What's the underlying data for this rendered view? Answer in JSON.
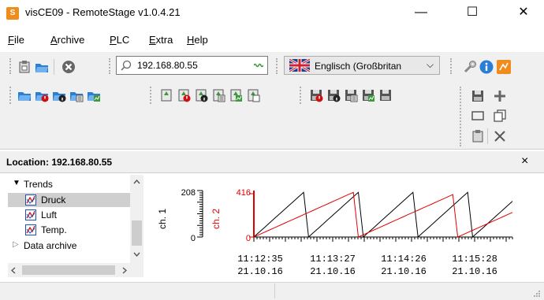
{
  "window": {
    "title": "visCE09 - RemoteStage v1.0.4.21",
    "app_icon_glyph": "S",
    "minimize_glyph": "—",
    "maximize_glyph": "☐",
    "close_glyph": "✕"
  },
  "menu": {
    "items": [
      {
        "accel": "F",
        "rest": "ile"
      },
      {
        "accel": "A",
        "rest": "rchive"
      },
      {
        "accel": "P",
        "rest": "LC"
      },
      {
        "accel": "E",
        "rest": "xtra"
      },
      {
        "accel": "H",
        "rest": "elp"
      }
    ]
  },
  "toolbar": {
    "address": "192.168.80.55",
    "address_icon": "search-icon",
    "language": "Englisch (Großbritan",
    "language_dropdown_glyph": "⌵"
  },
  "location": {
    "label": "Location: 192.168.80.55",
    "close_glyph": "×"
  },
  "tree": {
    "root": "Trends",
    "root_expand_glyph": "▼",
    "children": [
      "Druck",
      "Luft",
      "Temp."
    ],
    "selected": "Druck",
    "archive": "Data archive",
    "archive_expand_glyph": "▷"
  },
  "colors": {
    "accent": "#f08c1e",
    "toolbar_blue": "#2a7fd4",
    "toolbar_green": "#3a9a3a",
    "series_1": "#000000",
    "series_2": "#e00000"
  },
  "chart_data": {
    "type": "line",
    "ch1_label": "ch. 1",
    "ch2_label": "ch. 2",
    "ch1_ylim": [
      0,
      208
    ],
    "ch1_ticks": [
      "208",
      "0"
    ],
    "ch2_ylim": [
      0,
      416
    ],
    "ch2_ticks": [
      "416",
      "0"
    ],
    "x_ticks": [
      {
        "time": "11:12:35",
        "date": "21.10.16"
      },
      {
        "time": "11:13:27",
        "date": "21.10.16"
      },
      {
        "time": "11:14:26",
        "date": "21.10.16"
      },
      {
        "time": "11:15:28",
        "date": "21.10.16"
      }
    ],
    "series": [
      {
        "values": [
          0,
          20,
          40,
          60,
          80,
          100,
          120,
          140,
          160,
          180,
          200,
          0,
          20,
          40,
          60,
          80,
          100,
          120,
          140,
          160,
          180,
          200,
          0,
          20,
          40,
          60,
          80,
          100,
          120,
          140,
          160,
          180,
          200,
          0,
          20,
          40,
          60,
          80,
          100,
          120,
          140,
          160,
          180,
          200,
          0,
          20,
          40,
          60,
          80,
          100,
          120,
          140,
          160
        ]
      },
      {
        "values": [
          0,
          20,
          40,
          60,
          80,
          100,
          120,
          140,
          160,
          180,
          200,
          220,
          240,
          260,
          280,
          300,
          320,
          340,
          360,
          380,
          400,
          0,
          20,
          40,
          60,
          80,
          100,
          120,
          140,
          160,
          180,
          200,
          220,
          240,
          260,
          280,
          300,
          320,
          340,
          360,
          380,
          0,
          20,
          40,
          60,
          80,
          100,
          120,
          140,
          160,
          180,
          200,
          220
        ]
      }
    ]
  }
}
